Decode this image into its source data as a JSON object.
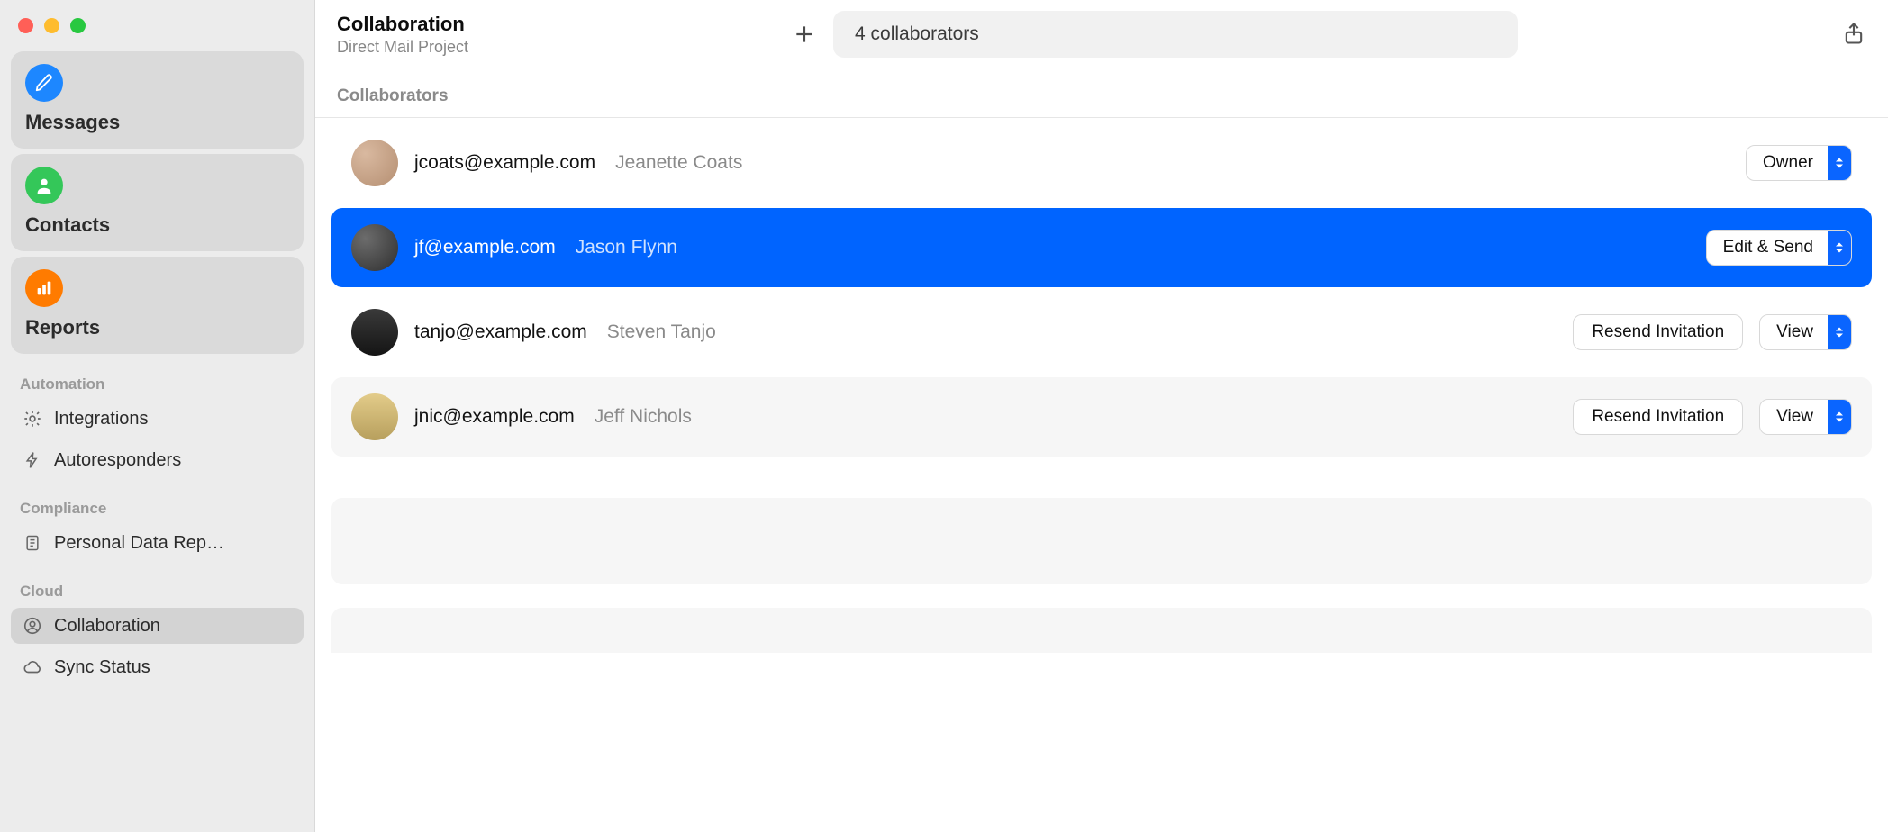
{
  "sidebar": {
    "cards": [
      {
        "label": "Messages",
        "icon": "pencil-icon"
      },
      {
        "label": "Contacts",
        "icon": "contact-icon"
      },
      {
        "label": "Reports",
        "icon": "chart-icon"
      }
    ],
    "sections": [
      {
        "title": "Automation",
        "items": [
          {
            "label": "Integrations",
            "icon": "gear-icon",
            "selected": false
          },
          {
            "label": "Autoresponders",
            "icon": "bolt-icon",
            "selected": false
          }
        ]
      },
      {
        "title": "Compliance",
        "items": [
          {
            "label": "Personal Data Rep…",
            "icon": "document-icon",
            "selected": false
          }
        ]
      },
      {
        "title": "Cloud",
        "items": [
          {
            "label": "Collaboration",
            "icon": "person-circle-icon",
            "selected": true
          },
          {
            "label": "Sync Status",
            "icon": "cloud-icon",
            "selected": false
          }
        ]
      }
    ]
  },
  "header": {
    "title": "Collaboration",
    "subtitle": "Direct Mail Project",
    "search_text": "4 collaborators",
    "section_title": "Collaborators"
  },
  "buttons": {
    "resend": "Resend Invitation"
  },
  "collaborators": [
    {
      "email": "jcoats@example.com",
      "name": "Jeanette Coats",
      "role": "Owner",
      "resend": false,
      "selected": false,
      "avatar": "a"
    },
    {
      "email": "jf@example.com",
      "name": "Jason Flynn",
      "role": "Edit & Send",
      "resend": false,
      "selected": true,
      "avatar": "b"
    },
    {
      "email": "tanjo@example.com",
      "name": "Steven Tanjo",
      "role": "View",
      "resend": true,
      "selected": false,
      "avatar": "c"
    },
    {
      "email": "jnic@example.com",
      "name": "Jeff Nichols",
      "role": "View",
      "resend": true,
      "selected": false,
      "avatar": "d"
    }
  ]
}
